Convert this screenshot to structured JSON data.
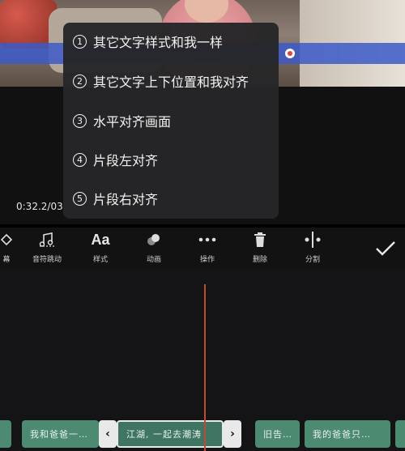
{
  "menu": {
    "items": [
      {
        "num": "1",
        "label": "其它文字样式和我一样"
      },
      {
        "num": "2",
        "label": "其它文字上下位置和我对齐"
      },
      {
        "num": "3",
        "label": "水平对齐画面"
      },
      {
        "num": "4",
        "label": "片段左对齐"
      },
      {
        "num": "5",
        "label": "片段右对齐"
      }
    ]
  },
  "preview": {
    "timecode": "0:32.2/03"
  },
  "toolbar": {
    "items": [
      {
        "label": "幕",
        "icon": "diamond-icon"
      },
      {
        "label": "音符跳动",
        "icon": "music-note-icon"
      },
      {
        "label": "样式",
        "icon": "text-style-icon",
        "glyph": "Aa"
      },
      {
        "label": "动画",
        "icon": "animation-icon"
      },
      {
        "label": "操作",
        "icon": "more-dots-icon"
      },
      {
        "label": "删除",
        "icon": "trash-icon"
      },
      {
        "label": "分割",
        "icon": "split-icon"
      }
    ],
    "confirm_icon": "check-icon"
  },
  "timeline": {
    "clips": [
      {
        "label": ""
      },
      {
        "label": "我和爸爸一…"
      },
      {
        "label": "江湖, 一起去潮涛"
      },
      {
        "label": "旧告…"
      },
      {
        "label": "我的爸爸只…"
      },
      {
        "label": ""
      }
    ],
    "prev_arrow": "‹",
    "next_arrow": "›"
  }
}
